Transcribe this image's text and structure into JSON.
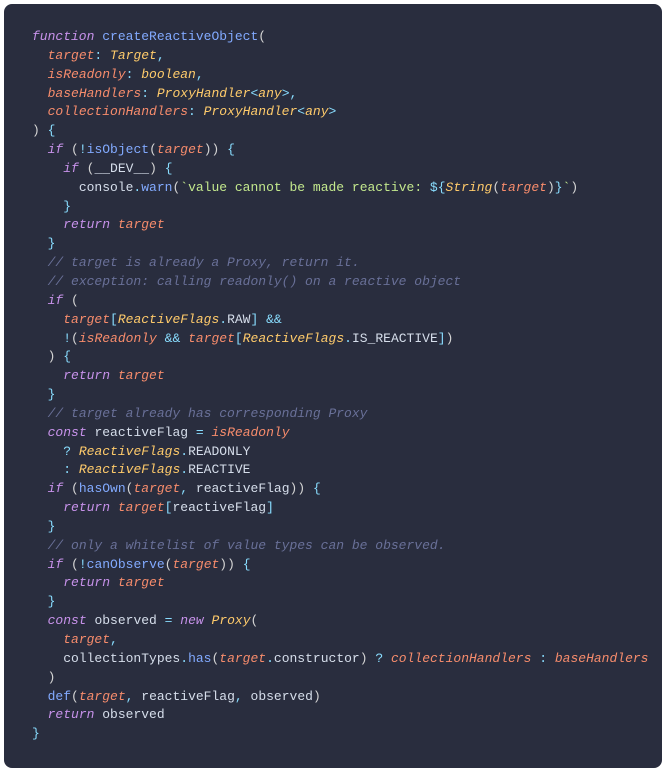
{
  "code": {
    "l1": {
      "kw": "function",
      "fn": "createReactiveObject",
      "p": "("
    },
    "l2": {
      "param": "target",
      "colon": ":",
      "type": "Target",
      "comma": ","
    },
    "l3": {
      "param": "isReadonly",
      "colon": ":",
      "type": "boolean",
      "comma": ","
    },
    "l4": {
      "param": "baseHandlers",
      "colon": ":",
      "type": "ProxyHandler",
      "lt": "<",
      "any": "any",
      "gt": ">",
      "comma": ","
    },
    "l5": {
      "param": "collectionHandlers",
      "colon": ":",
      "type": "ProxyHandler",
      "lt": "<",
      "any": "any",
      "gt": ">"
    },
    "l6": {
      "p1": ")",
      "brace": "{"
    },
    "l7": {
      "kw": "if",
      "p1": "(",
      "bang": "!",
      "fn": "isObject",
      "p2": "(",
      "arg": "target",
      "p3": ")",
      "p4": ")",
      "brace": "{"
    },
    "l8": {
      "kw": "if",
      "p1": "(",
      "dev": "__DEV__",
      "p2": ")",
      "brace": "{"
    },
    "l9": {
      "obj": "console",
      "dot": ".",
      "fn": "warn",
      "p1": "(",
      "bt1": "`",
      "str": "value cannot be made reactive: ",
      "dollar": "${",
      "sfn": "String",
      "p2": "(",
      "arg": "target",
      "p3": ")",
      "close": "}",
      "bt2": "`",
      "p4": ")"
    },
    "l10": {
      "brace": "}"
    },
    "l11": {
      "kw": "return",
      "val": "target"
    },
    "l12": {
      "brace": "}"
    },
    "l13": {
      "comment": "// target is already a Proxy, return it."
    },
    "l14": {
      "comment": "// exception: calling readonly() on a reactive object"
    },
    "l15": {
      "kw": "if",
      "p": "("
    },
    "l16": {
      "arg": "target",
      "b1": "[",
      "type": "ReactiveFlags",
      "dot": ".",
      "prop": "RAW",
      "b2": "]",
      "and": "&&"
    },
    "l17": {
      "bang": "!",
      "p1": "(",
      "a1": "isReadonly",
      "and": "&&",
      "a2": "target",
      "b1": "[",
      "type": "ReactiveFlags",
      "dot": ".",
      "prop": "IS_REACTIVE",
      "b2": "]",
      "p2": ")"
    },
    "l18": {
      "p": ")",
      "brace": "{"
    },
    "l19": {
      "kw": "return",
      "val": "target"
    },
    "l20": {
      "brace": "}"
    },
    "l21": {
      "comment": "// target already has corresponding Proxy"
    },
    "l22": {
      "kw": "const",
      "name": "reactiveFlag",
      "eq": "=",
      "val": "isReadonly"
    },
    "l23": {
      "q": "?",
      "type": "ReactiveFlags",
      "dot": ".",
      "prop": "READONLY"
    },
    "l24": {
      "q": ":",
      "type": "ReactiveFlags",
      "dot": ".",
      "prop": "REACTIVE"
    },
    "l25": {
      "kw": "if",
      "p1": "(",
      "fn": "hasOwn",
      "p2": "(",
      "a1": "target",
      "comma": ",",
      "a2": "reactiveFlag",
      "p3": ")",
      "p4": ")",
      "brace": "{"
    },
    "l26": {
      "kw": "return",
      "val": "target",
      "b1": "[",
      "idx": "reactiveFlag",
      "b2": "]"
    },
    "l27": {
      "brace": "}"
    },
    "l28": {
      "comment": "// only a whitelist of value types can be observed."
    },
    "l29": {
      "kw": "if",
      "p1": "(",
      "bang": "!",
      "fn": "canObserve",
      "p2": "(",
      "arg": "target",
      "p3": ")",
      "p4": ")",
      "brace": "{"
    },
    "l30": {
      "kw": "return",
      "val": "target"
    },
    "l31": {
      "brace": "}"
    },
    "l32": {
      "kw": "const",
      "name": "observed",
      "eq": "=",
      "new": "new",
      "cls": "Proxy",
      "p": "("
    },
    "l33": {
      "arg": "target",
      "comma": ","
    },
    "l34": {
      "obj": "collectionTypes",
      "dot": ".",
      "fn": "has",
      "p1": "(",
      "arg": "target",
      "dot2": ".",
      "prop": "constructor",
      "p2": ")",
      "q": "?",
      "a": "collectionHandlers",
      "colon": ":",
      "b": "baseHandlers"
    },
    "l35": {
      "p": ")"
    },
    "l36": {
      "fn": "def",
      "p1": "(",
      "a1": "target",
      "c1": ",",
      "a2": "reactiveFlag",
      "c2": ",",
      "a3": "observed",
      "p2": ")"
    },
    "l37": {
      "kw": "return",
      "val": "observed"
    },
    "l38": {
      "brace": "}"
    }
  }
}
